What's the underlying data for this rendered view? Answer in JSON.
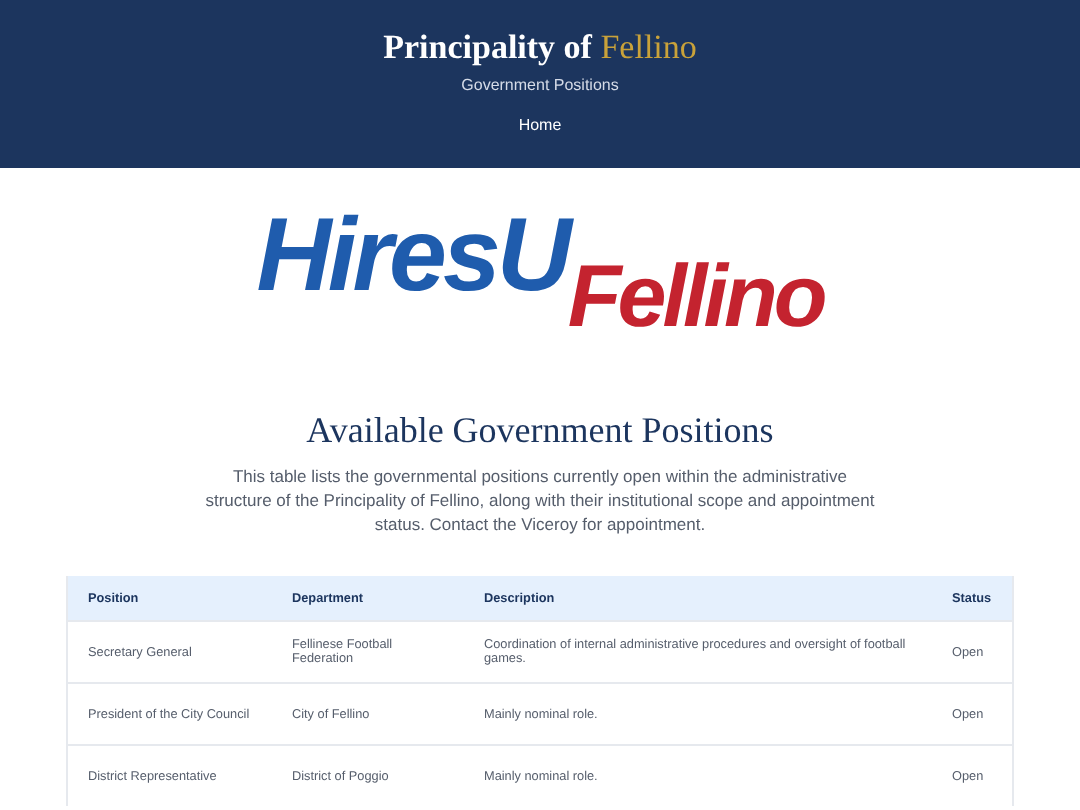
{
  "header": {
    "title": "Principality of",
    "title_highlight": "Fellino",
    "subtitle": "Government Positions",
    "nav": [
      {
        "label": "Home"
      }
    ]
  },
  "logo": {
    "part_1": "HiresU",
    "part_2": "Fellino"
  },
  "intro": {
    "heading": "Available Government Positions",
    "text": "This table lists the governmental positions currently open within the administrative structure of the Principality of Fellino, along with their institutional scope and appointment status. Contact the Viceroy for appointment."
  },
  "table": {
    "columns": [
      "Position",
      "Department",
      "Description",
      "Status"
    ],
    "rows": [
      [
        "Secretary General",
        "Fellinese Football Federation",
        "Coordination of internal administrative procedures and oversight of football games.",
        "Open"
      ],
      [
        "President of the City Council",
        "City of Fellino",
        "Mainly nominal role.",
        "Open"
      ],
      [
        "District Representative",
        "District of Poggio",
        "Mainly nominal role.",
        "Open"
      ]
    ]
  }
}
